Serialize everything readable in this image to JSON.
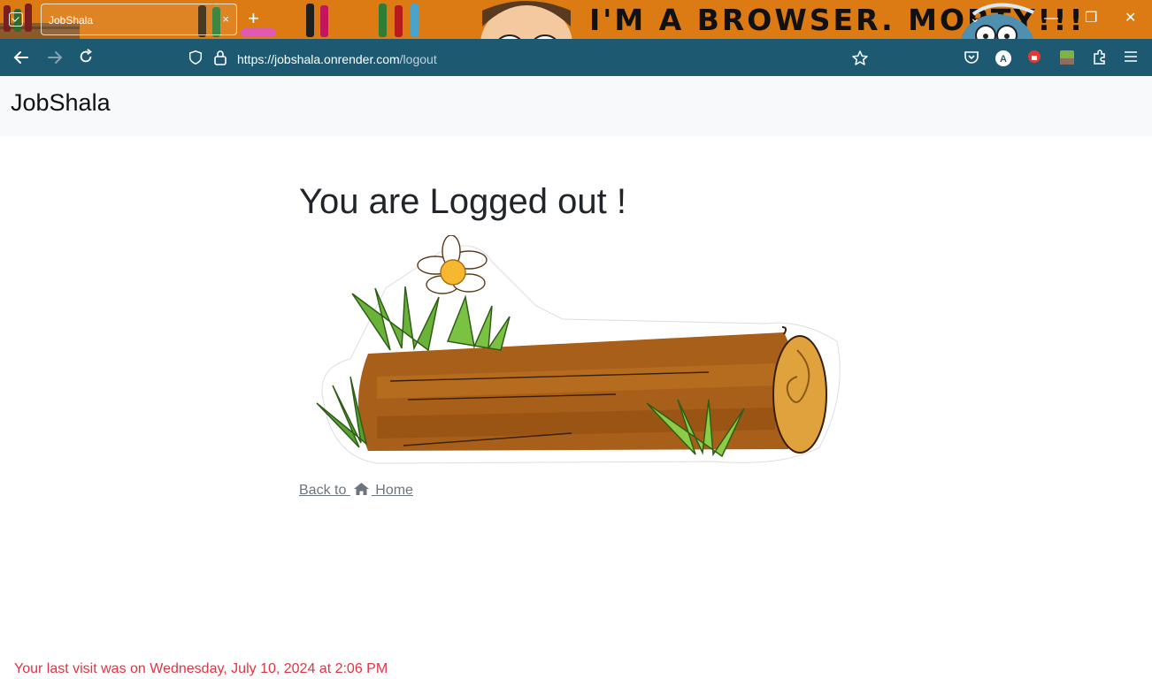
{
  "browser": {
    "tab_title": "JobShala",
    "tab_close": "×",
    "new_tab": "+",
    "theme_banner": "I'M A BROWSER. MORTY!!!",
    "url_host": "https://jobshala.onrender.com",
    "url_path": "/logout",
    "window_controls": {
      "minimize": "—",
      "maximize": "❐",
      "close": "✕"
    },
    "icons": [
      "tab-list-icon",
      "back-arrow-icon",
      "forward-arrow-icon",
      "reload-icon",
      "shield-icon",
      "lock-icon",
      "bookmark-star-icon",
      "pocket-icon",
      "account-icon",
      "extension-icon",
      "puzzle-icon",
      "menu-icon"
    ],
    "colors": {
      "tabstrip": "#dc7a13",
      "toolbar": "#1d5a72"
    }
  },
  "page": {
    "brand": "JobShala",
    "heading": "You are Logged out !",
    "back_link": {
      "before": "Back to",
      "after": "Home",
      "icon": "home-icon"
    },
    "last_visit": "Your last visit was on Wednesday, July 10, 2024 at 2:06 PM",
    "colors": {
      "navbar": "#f8f9fa",
      "link": "#6c757d",
      "last_visit": "#dc3545"
    }
  }
}
